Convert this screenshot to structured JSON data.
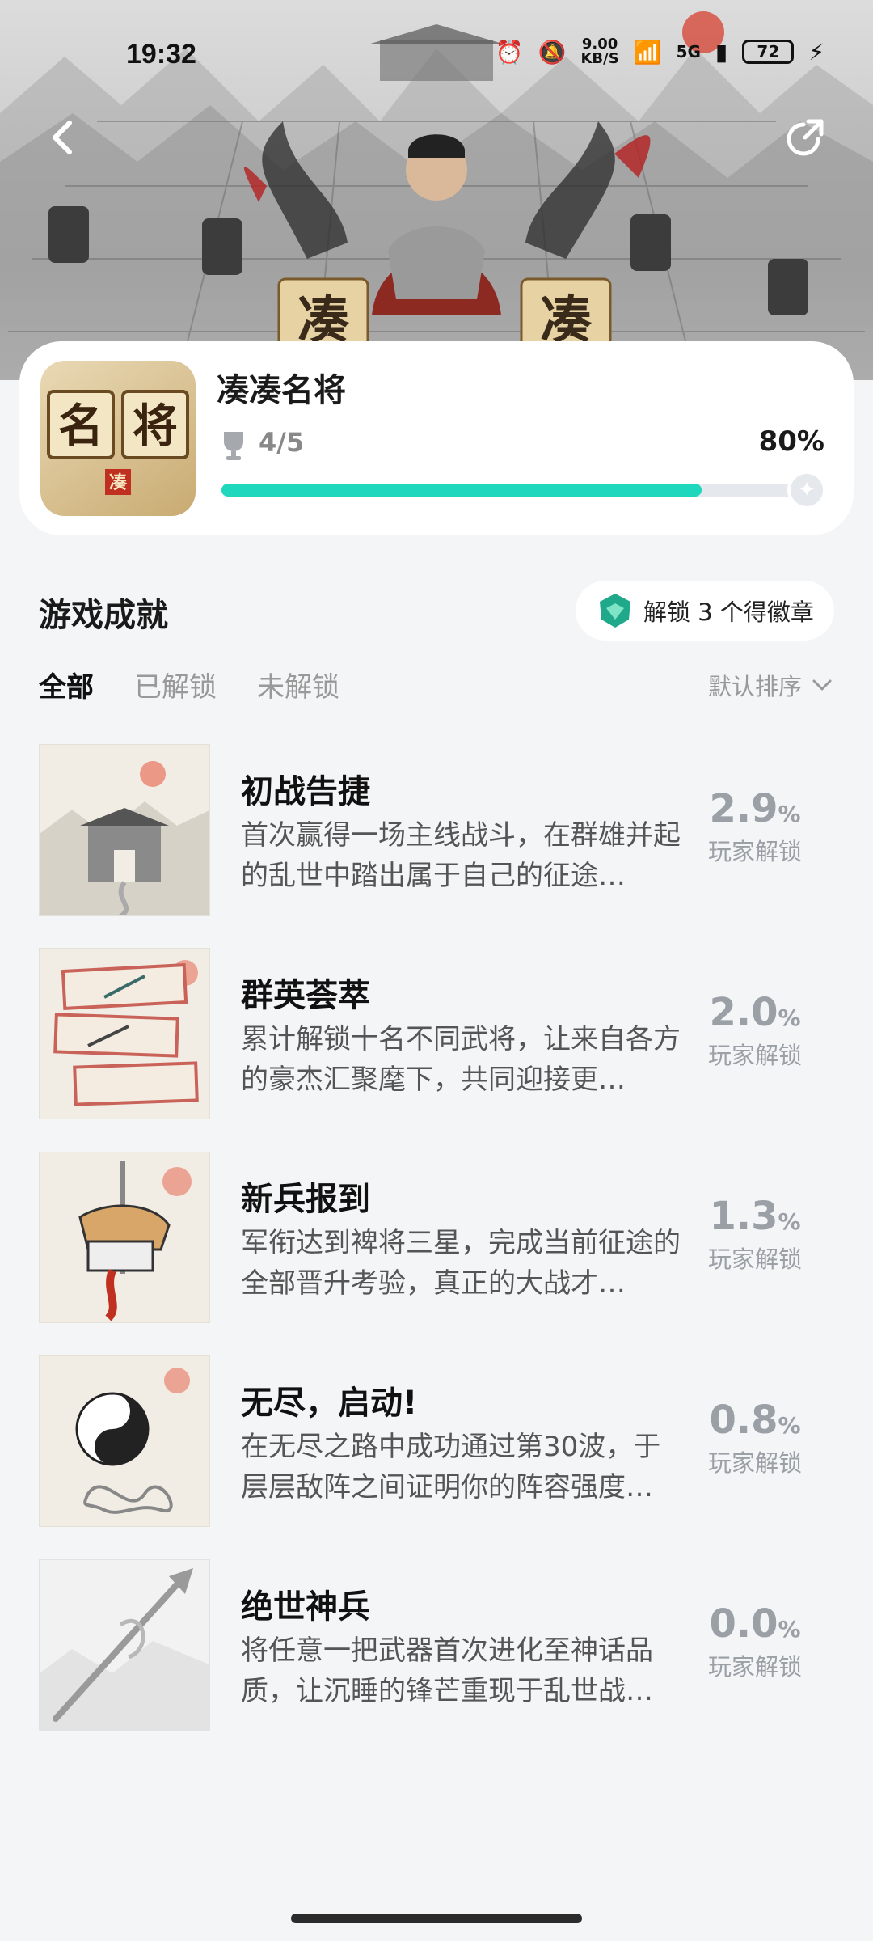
{
  "status_bar": {
    "time": "19:32",
    "net_speed": "9.00",
    "net_speed_unit": "KB/S",
    "network": "5G",
    "battery": "72"
  },
  "game": {
    "title": "凑凑名将",
    "achievements_progress": "4/5",
    "percent_text": "80%",
    "progress": 0.8,
    "logo_chars": [
      "名",
      "将",
      "凑"
    ]
  },
  "section": {
    "title": "游戏成就",
    "badge_text": "解锁 3 个得徽章",
    "sort_label": "默认排序"
  },
  "tabs": [
    {
      "label": "全部",
      "active": true
    },
    {
      "label": "已解锁",
      "active": false
    },
    {
      "label": "未解锁",
      "active": false
    }
  ],
  "achievements": [
    {
      "name": "初战告捷",
      "desc": "首次赢得一场主线战斗，在群雄并起的乱世中踏出属于自己的征途…",
      "rate": "2.9",
      "unit": "%",
      "rate_label": "玩家解锁",
      "icon": "fortress-gate-icon"
    },
    {
      "name": "群英荟萃",
      "desc": "累计解锁十名不同武将，让来自各方的豪杰汇聚麾下，共同迎接更…",
      "rate": "2.0",
      "unit": "%",
      "rate_label": "玩家解锁",
      "icon": "scroll-cards-icon"
    },
    {
      "name": "新兵报到",
      "desc": "军衔达到裨将三星，完成当前征途的全部晋升考验，真正的大战才…",
      "rate": "1.3",
      "unit": "%",
      "rate_label": "玩家解锁",
      "icon": "tiger-seal-icon"
    },
    {
      "name": "无尽，启动!",
      "desc": "在无尽之路中成功通过第30波，于层层敌阵之间证明你的阵容强度…",
      "rate": "0.8",
      "unit": "%",
      "rate_label": "玩家解锁",
      "icon": "yin-yang-icon"
    },
    {
      "name": "绝世神兵",
      "desc": "将任意一把武器首次进化至神话品质，让沉睡的锋芒重现于乱世战…",
      "rate": "0.0",
      "unit": "%",
      "rate_label": "玩家解锁",
      "icon": "legendary-spear-icon"
    }
  ]
}
